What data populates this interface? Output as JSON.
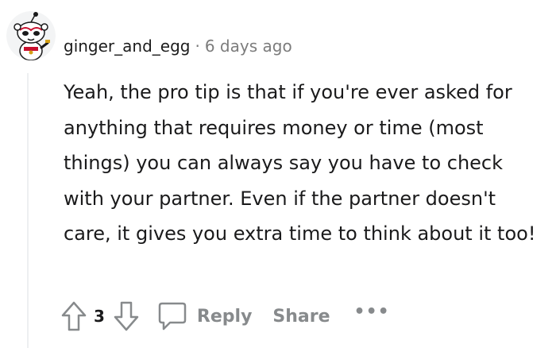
{
  "comment": {
    "username": "ginger_and_egg",
    "separator": "·",
    "timestamp": "6 days ago",
    "body": "Yeah, the pro tip is that if you're ever asked for anything that requires money or time (most things) you can always say you have to check with your partner. Even if the partner doesn't care, it gives you extra time to think about it too!",
    "vote_count": "3",
    "actions": {
      "reply_label": "Reply",
      "share_label": "Share",
      "more_label": "•••"
    },
    "icons": {
      "avatar": "snoo-avatar",
      "upvote": "upvote-arrow-icon",
      "downvote": "downvote-arrow-icon",
      "reply": "speech-bubble-icon"
    }
  }
}
